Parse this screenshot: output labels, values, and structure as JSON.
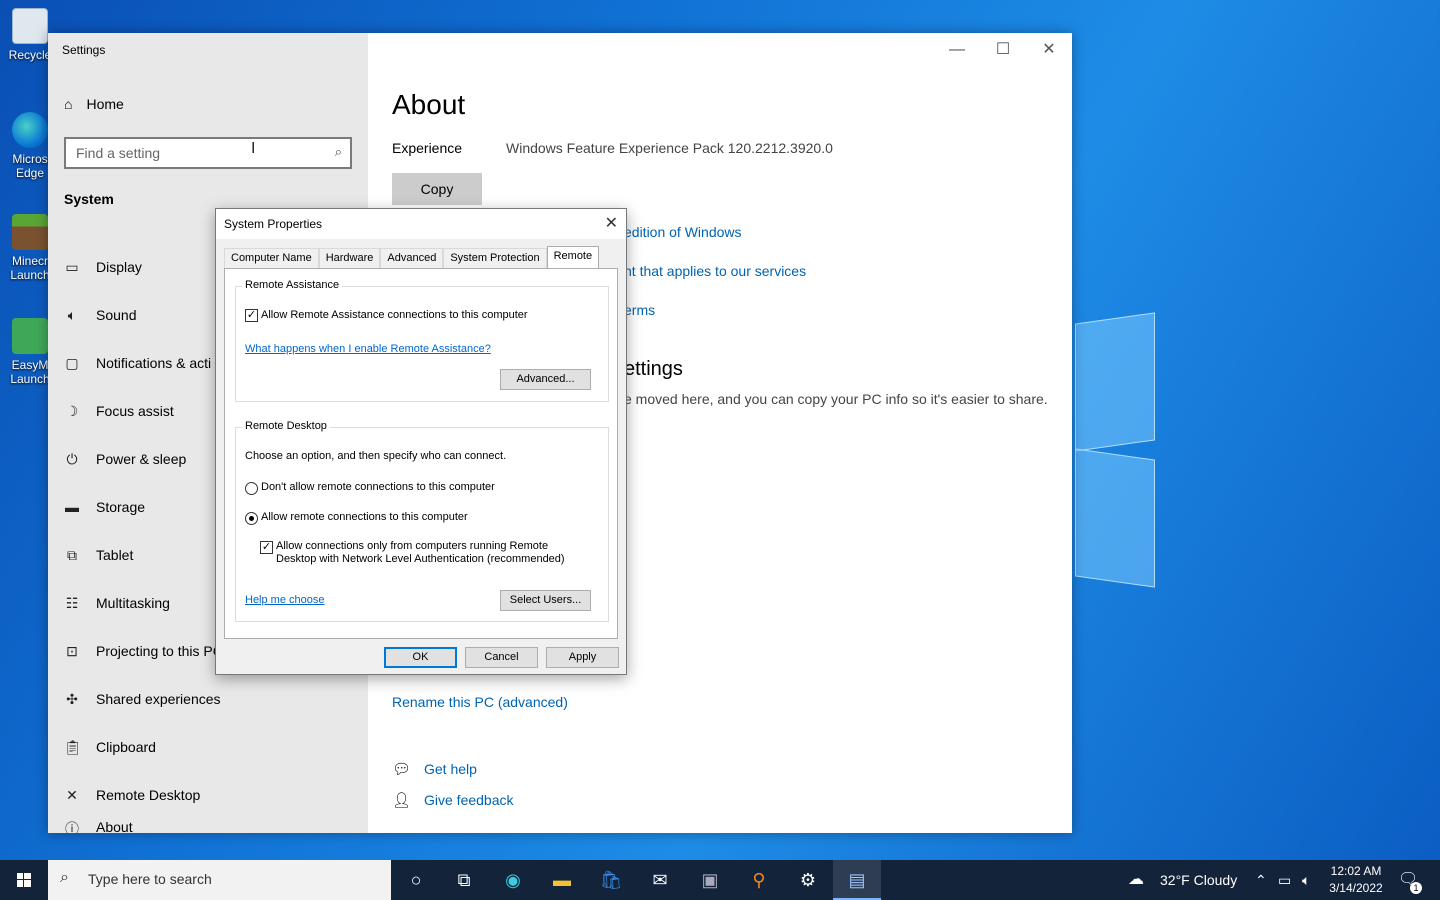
{
  "desktop": {
    "icons": [
      {
        "label": "Recycle"
      },
      {
        "label": "Micros\nEdge"
      },
      {
        "label": "Minecr\nLaunch"
      },
      {
        "label": "EasyM\nLaunch"
      }
    ]
  },
  "settings": {
    "title": "Settings",
    "home_label": "Home",
    "search_placeholder": "Find a setting",
    "section": "System",
    "nav": [
      {
        "label": "Display",
        "icon": "display-icon"
      },
      {
        "label": "Sound",
        "icon": "speaker-icon"
      },
      {
        "label": "Notifications & acti",
        "icon": "notification-icon"
      },
      {
        "label": "Focus assist",
        "icon": "moon-icon"
      },
      {
        "label": "Power & sleep",
        "icon": "power-icon"
      },
      {
        "label": "Storage",
        "icon": "storage-icon"
      },
      {
        "label": "Tablet",
        "icon": "tablet-icon"
      },
      {
        "label": "Multitasking",
        "icon": "multitasking-icon"
      },
      {
        "label": "Projecting to this PC",
        "icon": "projector-icon"
      },
      {
        "label": "Shared experiences",
        "icon": "share-icon"
      },
      {
        "label": "Clipboard",
        "icon": "clipboard-icon"
      },
      {
        "label": "Remote Desktop",
        "icon": "remote-desktop-icon"
      },
      {
        "label": "About",
        "icon": "info-icon"
      }
    ],
    "main": {
      "heading": "About",
      "experience_key": "Experience",
      "experience_value": "Windows Feature Experience Pack 120.2212.3920.0",
      "copy_label": "Copy",
      "link_edition": "edition of Windows",
      "link_services": "nt that applies to our services",
      "link_terms": "erms",
      "settings_heading": "ettings",
      "settings_text": "e moved here, and you can copy your PC info so it's easier to share.",
      "rename_link": "Rename this PC (advanced)",
      "get_help": "Get help",
      "give_feedback": "Give feedback"
    }
  },
  "dialog": {
    "title": "System Properties",
    "tabs": [
      "Computer Name",
      "Hardware",
      "Advanced",
      "System Protection",
      "Remote"
    ],
    "active_tab": "Remote",
    "remote_assistance": {
      "legend": "Remote Assistance",
      "allow_label": "Allow Remote Assistance connections to this computer",
      "allow_checked": true,
      "help_link": "What happens when I enable Remote Assistance?",
      "advanced_button": "Advanced..."
    },
    "remote_desktop": {
      "legend": "Remote Desktop",
      "instruction": "Choose an option, and then specify who can connect.",
      "option_deny": "Don't allow remote connections to this computer",
      "option_allow": "Allow remote connections to this computer",
      "selected": "allow",
      "nla_line1": "Allow connections only from computers running Remote",
      "nla_line2": "Desktop with Network Level Authentication (recommended)",
      "nla_checked": true,
      "help_link": "Help me choose",
      "select_users_button": "Select Users..."
    },
    "buttons": {
      "ok": "OK",
      "cancel": "Cancel",
      "apply": "Apply"
    }
  },
  "taskbar": {
    "search_placeholder": "Type here to search",
    "weather": "32°F  Cloudy",
    "time": "12:02 AM",
    "date": "3/14/2022",
    "notification_count": "1"
  }
}
